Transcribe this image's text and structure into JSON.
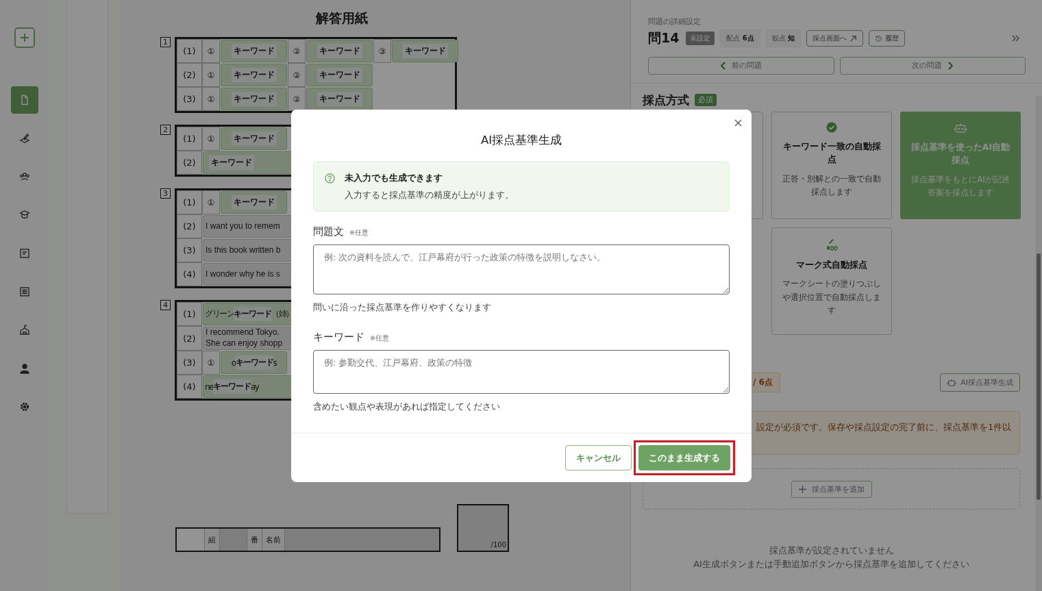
{
  "sidebar": {
    "items": [
      {
        "kind": "add",
        "selected": false
      },
      {
        "kind": "document",
        "selected": true
      },
      {
        "kind": "pen",
        "selected": false
      },
      {
        "kind": "group",
        "selected": false
      },
      {
        "kind": "graduate",
        "selected": false
      },
      {
        "kind": "exam",
        "selected": false
      },
      {
        "kind": "list",
        "selected": false
      },
      {
        "kind": "school",
        "selected": false
      },
      {
        "kind": "user",
        "selected": false
      },
      {
        "kind": "settings",
        "selected": false
      }
    ]
  },
  "sheet": {
    "title": "解答用紙",
    "sections": [
      {
        "number": "1",
        "rows": [
          {
            "label": "(1)",
            "cells": [
              {
                "kind": "circle",
                "text": "①"
              },
              {
                "kind": "keyword",
                "text": "キーワード"
              },
              {
                "kind": "circle",
                "text": "②"
              },
              {
                "kind": "keyword",
                "text": "キーワード"
              },
              {
                "kind": "circle",
                "text": "③"
              },
              {
                "kind": "keyword",
                "text": "キーワード"
              }
            ]
          },
          {
            "label": "(2)",
            "cells": [
              {
                "kind": "circle",
                "text": "①"
              },
              {
                "kind": "keyword",
                "text": "キーワード"
              },
              {
                "kind": "circle",
                "text": "②"
              },
              {
                "kind": "keyword",
                "text": "キーワード"
              }
            ]
          },
          {
            "label": "(3)",
            "cells": [
              {
                "kind": "circle",
                "text": "①"
              },
              {
                "kind": "keyword",
                "text": "キーワード"
              },
              {
                "kind": "circle",
                "text": "②"
              },
              {
                "kind": "keyword",
                "text": "キーワード"
              }
            ]
          }
        ]
      },
      {
        "number": "2",
        "rows": [
          {
            "label": "(1)",
            "cells": [
              {
                "kind": "circle",
                "text": "①"
              },
              {
                "kind": "keyword",
                "text": "キーワード"
              }
            ]
          },
          {
            "label": "(2)",
            "cells": [
              {
                "kind": "keyword",
                "text": "キーワード"
              }
            ]
          }
        ]
      },
      {
        "number": "3",
        "rows": [
          {
            "label": "(1)",
            "cells": [
              {
                "kind": "circle",
                "text": "①"
              },
              {
                "kind": "keyword",
                "text": "キーワード"
              }
            ]
          },
          {
            "label": "(2)",
            "cells": [
              {
                "kind": "text",
                "lines": [
                  "I want you to remem"
                ]
              }
            ]
          },
          {
            "label": "(3)",
            "cells": [
              {
                "kind": "text",
                "lines": [
                  "Is this book written b"
                ]
              }
            ]
          },
          {
            "label": "(4)",
            "cells": [
              {
                "kind": "text",
                "lines": [
                  "I wonder why he is s"
                ]
              }
            ]
          }
        ]
      },
      {
        "number": "4",
        "rows": [
          {
            "label": "(1)",
            "cells": [
              {
                "kind": "keyword",
                "prefix": "グリーン",
                "text": "キーワード",
                "suffix": "（姉）"
              }
            ]
          },
          {
            "label": "(2)",
            "cells": [
              {
                "kind": "text",
                "lines": [
                  "I recommend Tokyo.",
                  "She can enjoy shopp"
                ]
              }
            ]
          },
          {
            "label": "(3)",
            "cells": [
              {
                "kind": "circle",
                "text": "①"
              },
              {
                "kind": "keyword",
                "prefix": "o",
                "text": "キーワード",
                "suffix": "s"
              }
            ]
          },
          {
            "label": "(4)",
            "cells": [
              {
                "kind": "keyword",
                "prefix": "ne",
                "text": "キーワード",
                "suffix": "ay"
              }
            ]
          }
        ]
      }
    ],
    "name_row": {
      "class_label": "組",
      "number_label": "番",
      "name_label": "名前"
    },
    "score_box": {
      "total": "/100"
    }
  },
  "panel": {
    "caption": "問題の詳細設定",
    "question": "問14",
    "status": "未設定",
    "chips": [
      {
        "label": "配点",
        "value": "6点"
      },
      {
        "label": "観点",
        "value": "知"
      }
    ],
    "buttons": [
      {
        "kind": "external",
        "label": "採点画面へ"
      },
      {
        "kind": "history",
        "label": "履歴"
      }
    ],
    "prev": "前の問題",
    "next": "次の問題",
    "method": {
      "title": "採点方式",
      "badge": "必須",
      "cards": [
        {
          "kind": "keyword",
          "title": "キーワード一致の自動採点",
          "description": "正答・別解との一致で自動採点します",
          "selected": false
        },
        {
          "kind": "ai",
          "title": "採点基準を使ったAI自動採点",
          "description": "採点基準をもとにAIが記述答案を採点します",
          "selected": true
        },
        {
          "kind": "mark",
          "title": "マーク式自動採点",
          "description": "マークシートの塗りつぶしや選択位置で自動採点します",
          "selected": false
        }
      ]
    },
    "score": "/ 6点",
    "ai_button": "AI採点基準生成",
    "warning": "設定が必須です。保存や採点設定の完了前に、採点基準を1件以",
    "add_button": "採点基準を追加",
    "empty": [
      "採点基準が設定されていません",
      "AI生成ボタンまたは手動追加ボタンから採点基準を追加してください"
    ]
  },
  "modal": {
    "title": "AI採点基準生成",
    "info": {
      "title": "未入力でも生成できます",
      "text": "入力すると採点基準の精度が上がります。"
    },
    "fields": [
      {
        "label": "問題文",
        "note": "※任意",
        "placeholder": "例: 次の資料を読んで、江戸幕府が行った政策の特徴を説明しなさい。",
        "help": "問いに沿った採点基準を作りやすくなります",
        "kind": "tall"
      },
      {
        "label": "キーワード",
        "note": "※任意",
        "placeholder": "例: 参勤交代、江戸幕府、政策の特徴",
        "help": "含めたい観点や表現があれば指定してください",
        "kind": "short"
      }
    ],
    "buttons": [
      {
        "kind": "secondary",
        "label": "キャンセル",
        "highlighted": false
      },
      {
        "kind": "primary",
        "label": "このまま生成する",
        "highlighted": true
      }
    ]
  }
}
